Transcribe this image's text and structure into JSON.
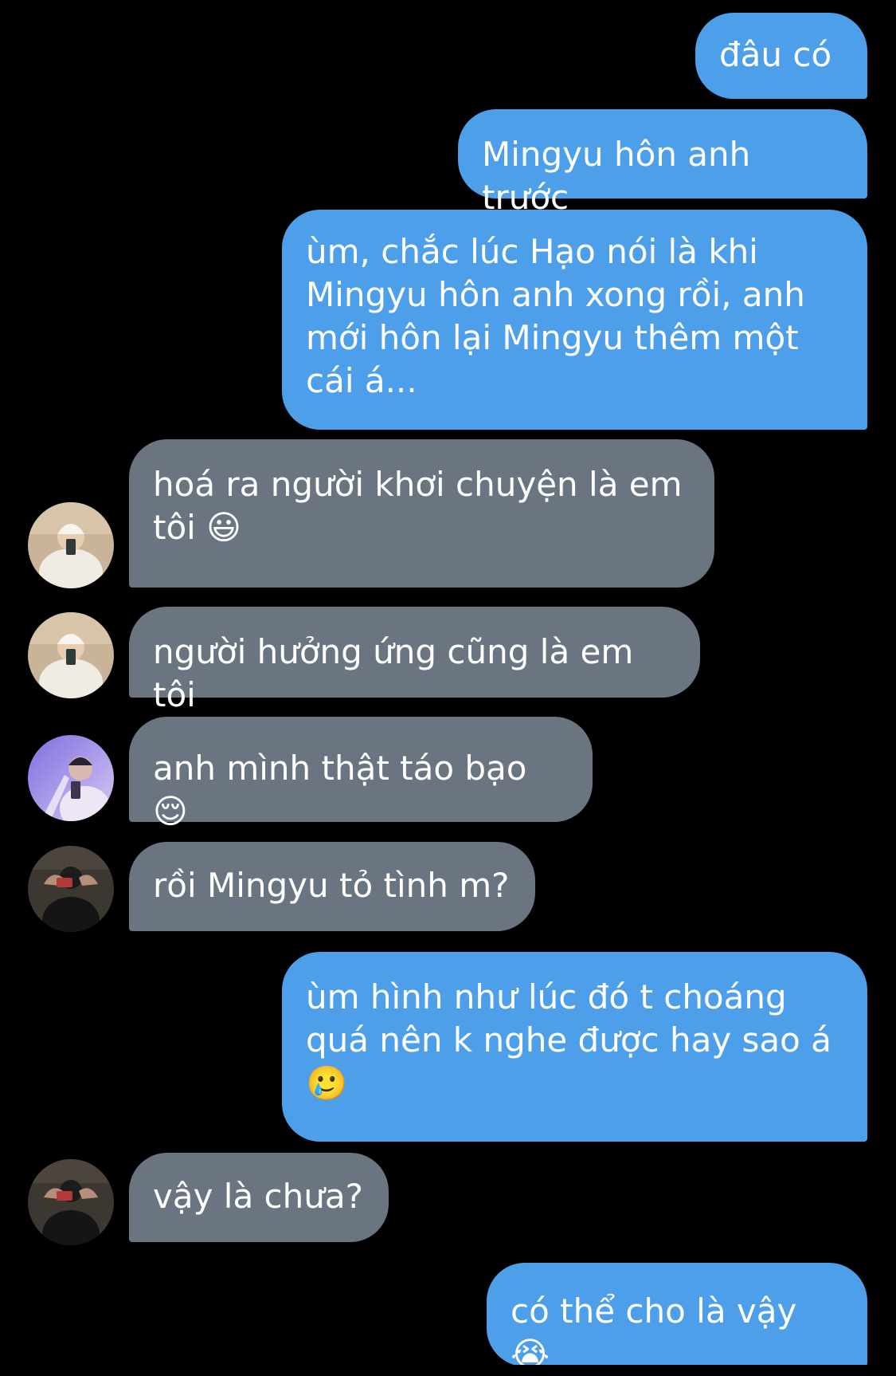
{
  "conversation": {
    "messages": [
      {
        "direction": "out",
        "text": "đâu có"
      },
      {
        "direction": "out",
        "text": "Mingyu hôn anh trước"
      },
      {
        "direction": "out",
        "text": "ùm, chắc lúc Hạo nói là khi Mingyu hôn anh xong rồi, anh mới hôn lại Mingyu thêm một cái á..."
      },
      {
        "direction": "in",
        "avatar": "avatar-white-beanie",
        "text": "hoá ra người khơi chuyện là em tôi 😃"
      },
      {
        "direction": "in",
        "avatar": "avatar-white-beanie",
        "text": "người hưởng ứng cũng là em tôi"
      },
      {
        "direction": "in",
        "avatar": "avatar-purple-mirror",
        "text": "anh mình thật táo bạo 😌"
      },
      {
        "direction": "in",
        "avatar": "avatar-dark-mirror",
        "text": "rồi Mingyu tỏ tình m?"
      },
      {
        "direction": "out",
        "text": "ùm hình như lúc đó t choáng quá nên k nghe được hay sao á 🥲"
      },
      {
        "direction": "in",
        "avatar": "avatar-dark-mirror",
        "text": "vậy là chưa?"
      },
      {
        "direction": "out",
        "text": "có thể cho là vậy 😭"
      }
    ]
  },
  "colors": {
    "background": "#000000",
    "outgoing_bubble": "#4e9fea",
    "incoming_bubble": "#6b7481",
    "text": "#ffffff"
  }
}
